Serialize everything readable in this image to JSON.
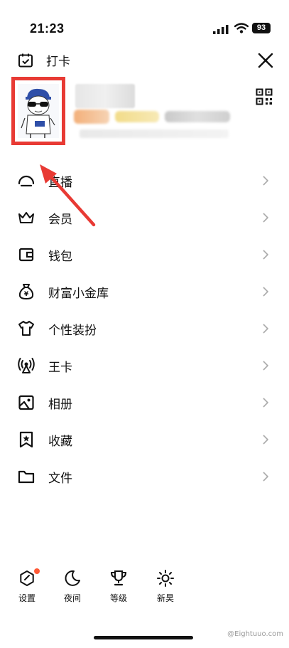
{
  "status_bar": {
    "time": "21:23",
    "battery": "93"
  },
  "header": {
    "checkin_label": "打卡"
  },
  "menu": [
    {
      "label": "直播",
      "icon": "live-icon"
    },
    {
      "label": "会员",
      "icon": "crown-icon"
    },
    {
      "label": "钱包",
      "icon": "wallet-icon"
    },
    {
      "label": "财富小金库",
      "icon": "money-bag-icon"
    },
    {
      "label": "个性装扮",
      "icon": "tshirt-icon"
    },
    {
      "label": "王卡",
      "icon": "signal-card-icon"
    },
    {
      "label": "相册",
      "icon": "album-icon"
    },
    {
      "label": "收藏",
      "icon": "bookmark-icon"
    },
    {
      "label": "文件",
      "icon": "folder-icon"
    }
  ],
  "bottom_bar": [
    {
      "label": "设置",
      "icon": "settings-icon",
      "has_dot": true
    },
    {
      "label": "夜间",
      "icon": "moon-icon",
      "has_dot": false
    },
    {
      "label": "等级",
      "icon": "trophy-icon",
      "has_dot": false
    },
    {
      "label": "新昊",
      "icon": "sun-icon",
      "has_dot": false
    }
  ],
  "watermark": "@Eightuuo.com",
  "colors": {
    "highlight_border": "#e83a34",
    "notification_dot": "#ff5a36",
    "text": "#111111"
  }
}
